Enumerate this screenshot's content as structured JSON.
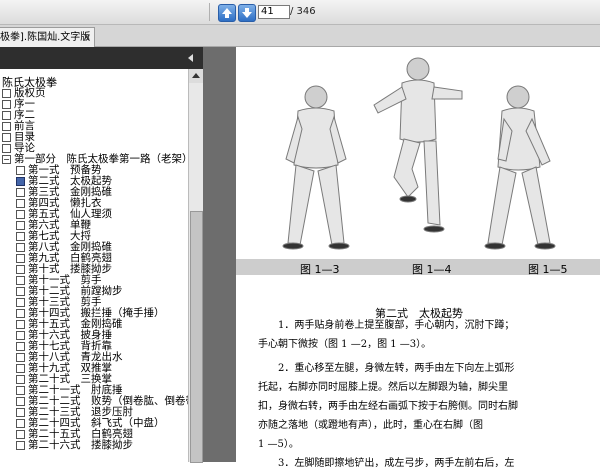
{
  "toolbar": {
    "icons": [
      "up-arrow-icon",
      "down-arrow-icon"
    ],
    "page_current": "41",
    "page_total": "/ 346"
  },
  "tab": {
    "label": "极拳].陈国灿.文字版",
    "close": "×"
  },
  "sidebar": {
    "root": "陈氏太极拳",
    "items": [
      {
        "label": "版权页"
      },
      {
        "label": "序一"
      },
      {
        "label": "序二"
      },
      {
        "label": "前言"
      },
      {
        "label": "目录"
      },
      {
        "label": "导论"
      },
      {
        "label": "第一部分　陈氏太极拳第一路（老架）"
      },
      {
        "label": "第一式　预备势"
      },
      {
        "label": "第二式　太极起势"
      },
      {
        "label": "第三式　金刚捣碓"
      },
      {
        "label": "第四式　懒扎衣"
      },
      {
        "label": "第五式　仙人理须"
      },
      {
        "label": "第六式　单鞭"
      },
      {
        "label": "第七式　大捋"
      },
      {
        "label": "第八式　金刚捣碓"
      },
      {
        "label": "第九式　白鹤亮翅"
      },
      {
        "label": "第十式　搂膝拗步"
      },
      {
        "label": "第十一式　剪手"
      },
      {
        "label": "第十二式　前蹚拗步"
      },
      {
        "label": "第十三式　剪手"
      },
      {
        "label": "第十四式　搬拦捶（掩手捶）"
      },
      {
        "label": "第十五式　金刚捣碓"
      },
      {
        "label": "第十六式　披身捶"
      },
      {
        "label": "第十七式　背折靠"
      },
      {
        "label": "第十八式　青龙出水"
      },
      {
        "label": "第十九式　双推掌"
      },
      {
        "label": "第二十式　三换掌"
      },
      {
        "label": "第二十一式　肘底捶"
      },
      {
        "label": "第二十二式　败势（倒卷肱、倒卷带、"
      },
      {
        "label": "第二十三式　退步压肘"
      },
      {
        "label": "第二十四式　斜飞式（中盘）"
      },
      {
        "label": "第二十五式　白鹤亮翅"
      },
      {
        "label": "第二十六式　搂膝拗步"
      }
    ]
  },
  "document": {
    "captions": [
      "图 1—3",
      "图 1—4",
      "图 1—5"
    ],
    "section_title": "第二式　太极起势",
    "paragraphs": [
      "　　1．两手贴身前卷上提至腹部，手心朝内，沉肘下蹲；",
      "手心朝下微按（图 1 —2，图 1 —3）。",
      "　　2．重心移至左腿，身微左转，两手由左下向左上弧形",
      "托起，右脚亦同时屈膝上提。然后以左脚跟为轴，脚尖里",
      "扣，身微右转，两手由左经右画弧下按于右胯侧。同时右脚",
      "亦随之落地（或蹬地有声），此时，重心在右脚（图",
      "1 —5）。",
      "　　3．左脚随即擦地铲出，成左弓步，两手左前右后，左"
    ]
  },
  "colors": {
    "sidebar_dark": "#3c3c3c",
    "page_background": "#6d6d6d",
    "caption_bar": "#cdcdcd",
    "arrow_blue": "#2f6fc4"
  }
}
